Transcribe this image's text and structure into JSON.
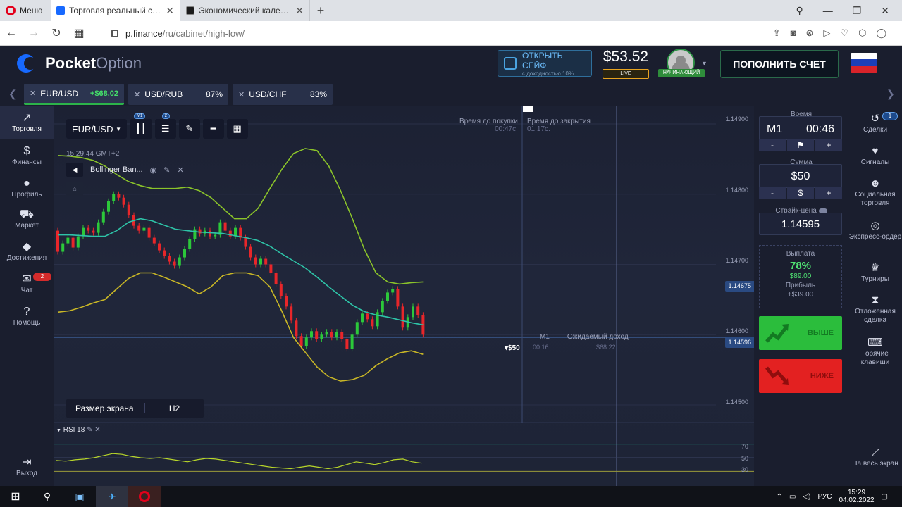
{
  "browser": {
    "menu_label": "Меню",
    "tabs": [
      {
        "label": "Торговля реальный счет",
        "active": true,
        "favicon_color": "#1769ff"
      },
      {
        "label": "Экономический календарь",
        "active": false,
        "favicon_color": "#1c1c1c"
      }
    ],
    "new_tab": "+",
    "url_host": "p.finance",
    "url_path": "/ru/cabinet/high-low/"
  },
  "header": {
    "logo_bold": "Pocket",
    "logo_light": "Option",
    "safe_title": "ОТКРЫТЬ СЕЙФ",
    "safe_subtitle": "с доходностью 10%",
    "balance": "$53.52",
    "account_type": "LIVE",
    "user_level": "НАЧИНАЮЩИЙ",
    "deposit_label": "ПОПОЛНИТЬ СЧЕТ",
    "flag_colors": [
      "#ffffff",
      "#1c3fb8",
      "#d8232a"
    ]
  },
  "assets": [
    {
      "name": "EUR/USD",
      "profit": "+$68.02",
      "active": true
    },
    {
      "name": "USD/RUB",
      "pct": "87%",
      "active": false
    },
    {
      "name": "USD/CHF",
      "pct": "83%",
      "active": false
    }
  ],
  "left_nav": [
    {
      "label": "Торговля",
      "icon": "chart-icon",
      "glyph": "📈",
      "active": true
    },
    {
      "label": "Финансы",
      "icon": "dollar-icon",
      "glyph": "$"
    },
    {
      "label": "Профиль",
      "icon": "user-icon",
      "glyph": "●"
    },
    {
      "label": "Маркет",
      "icon": "cart-icon",
      "glyph": "🛒"
    },
    {
      "label": "Достижения",
      "icon": "diamond-icon",
      "glyph": "◆"
    },
    {
      "label": "Чат",
      "icon": "chat-icon",
      "glyph": "💬",
      "badge": "2"
    },
    {
      "label": "Помощь",
      "icon": "help-icon",
      "glyph": "?"
    }
  ],
  "exit_label": "Выход",
  "chart": {
    "pair_selector": "EUR/USD",
    "timeframe_badge": "M1",
    "indicators_badge": "2",
    "timestamp": "15:29:44 GMT+2",
    "indicator_name": "Bollinger Ban...",
    "screen_size_label": "Размер экрана",
    "screen_size_value": "H2",
    "purchase_label": "Время до покупки",
    "purchase_time": "00:47с.",
    "close_label": "Время до закрытия",
    "close_time": "01:17с.",
    "current_price": "1.14596",
    "crosshair_price": "1.14675",
    "expected_label": "Ожидаемый доход",
    "expected_value": "$68.22",
    "open_trade_tf": "M1",
    "open_trade_time": "00:16",
    "open_trade_amount": "$50",
    "rsi_label": "RSI 18",
    "rsi_levels": [
      "70",
      "50",
      "30"
    ]
  },
  "chart_data": {
    "type": "candlestick",
    "price_axis": {
      "ticks": [
        "1.14900",
        "1.14800",
        "1.14700",
        "1.14600",
        "1.14500"
      ],
      "ylim": [
        1.14475,
        1.14925
      ]
    },
    "bollinger": {
      "upper": [
        1.14855,
        1.14854,
        1.14852,
        1.14848,
        1.1484,
        1.14828,
        1.14818,
        1.14812,
        1.14808,
        1.14808,
        1.14808,
        1.1481,
        1.14805,
        1.14795,
        1.1478,
        1.14765,
        1.14765,
        1.1478,
        1.14808,
        1.14835,
        1.14858,
        1.14865,
        1.14862,
        1.1484,
        1.14805,
        1.14765,
        1.14722,
        1.14688,
        1.14675,
        1.14672,
        1.14674,
        1.14675
      ],
      "middle": [
        1.14742,
        1.14742,
        1.14741,
        1.1474,
        1.1474,
        1.14748,
        1.1476,
        1.14765,
        1.14762,
        1.14756,
        1.1475,
        1.14748,
        1.14746,
        1.14745,
        1.14744,
        1.14741,
        1.14738,
        1.14734,
        1.14726,
        1.14715,
        1.14705,
        1.14695,
        1.14682,
        1.14668,
        1.14655,
        1.14642,
        1.14633,
        1.14628,
        1.14625,
        1.14621,
        1.14617,
        1.14614
      ],
      "lower": [
        1.14632,
        1.14634,
        1.14639,
        1.14645,
        1.1465,
        1.14665,
        1.1468,
        1.14688,
        1.14688,
        1.14682,
        1.14675,
        1.14668,
        1.14658,
        1.14668,
        1.14684,
        1.14688,
        1.14688,
        1.14684,
        1.14668,
        1.14634,
        1.14596,
        1.14575,
        1.14554,
        1.1454,
        1.14534,
        1.14536,
        1.14542,
        1.14556,
        1.14566,
        1.14574,
        1.14577,
        1.14572
      ]
    },
    "candles": [
      [
        1.14748,
        1.14718
      ],
      [
        1.14718,
        1.1473
      ],
      [
        1.1473,
        1.14738
      ],
      [
        1.14738,
        1.14724
      ],
      [
        1.14724,
        1.1474
      ],
      [
        1.1474,
        1.14752
      ],
      [
        1.14752,
        1.14748
      ],
      [
        1.14748,
        1.14745
      ],
      [
        1.14745,
        1.1476
      ],
      [
        1.1476,
        1.14775
      ],
      [
        1.14775,
        1.1479
      ],
      [
        1.1479,
        1.148
      ],
      [
        1.148,
        1.14795
      ],
      [
        1.14795,
        1.14785
      ],
      [
        1.14785,
        1.1477
      ],
      [
        1.1477,
        1.14755
      ],
      [
        1.14755,
        1.14748
      ],
      [
        1.14748,
        1.14752
      ],
      [
        1.14752,
        1.14738
      ],
      [
        1.14738,
        1.1473
      ],
      [
        1.1473,
        1.1472
      ],
      [
        1.1472,
        1.14712
      ],
      [
        1.14712,
        1.14704
      ],
      [
        1.14704,
        1.14698
      ],
      [
        1.14698,
        1.1471
      ],
      [
        1.1471,
        1.14722
      ],
      [
        1.14722,
        1.14736
      ],
      [
        1.14736,
        1.1475
      ],
      [
        1.1475,
        1.14744
      ],
      [
        1.14744,
        1.14748
      ],
      [
        1.14748,
        1.1474
      ],
      [
        1.1474,
        1.14742
      ],
      [
        1.14742,
        1.1476
      ],
      [
        1.1476,
        1.14748
      ],
      [
        1.14748,
        1.1474
      ],
      [
        1.1474,
        1.14752
      ],
      [
        1.14752,
        1.14738
      ],
      [
        1.14738,
        1.14725
      ],
      [
        1.14725,
        1.1471
      ],
      [
        1.1471,
        1.147
      ],
      [
        1.147,
        1.14708
      ],
      [
        1.14708,
        1.147
      ],
      [
        1.147,
        1.14688
      ],
      [
        1.14688,
        1.14672
      ],
      [
        1.14672,
        1.14655
      ],
      [
        1.14655,
        1.1464
      ],
      [
        1.1464,
        1.1462
      ],
      [
        1.1462,
        1.14598
      ],
      [
        1.14598,
        1.14584
      ],
      [
        1.14584,
        1.14596
      ],
      [
        1.14596,
        1.14605
      ],
      [
        1.14605,
        1.14594
      ],
      [
        1.14594,
        1.146
      ],
      [
        1.146,
        1.14604
      ],
      [
        1.14604,
        1.14596
      ],
      [
        1.14596,
        1.14604
      ],
      [
        1.14604,
        1.14594
      ],
      [
        1.14594,
        1.1458
      ],
      [
        1.1458,
        1.146
      ],
      [
        1.146,
        1.14618
      ],
      [
        1.14618,
        1.1463
      ],
      [
        1.1463,
        1.14622
      ],
      [
        1.14622,
        1.14612
      ],
      [
        1.14612,
        1.14632
      ],
      [
        1.14632,
        1.14648
      ],
      [
        1.14648,
        1.1466
      ],
      [
        1.1466,
        1.14665
      ],
      [
        1.14665,
        1.1464
      ],
      [
        1.1464,
        1.1461
      ],
      [
        1.1461,
        1.14625
      ],
      [
        1.14625,
        1.1464
      ],
      [
        1.1464,
        1.14628
      ],
      [
        1.14628,
        1.146
      ]
    ],
    "rsi": {
      "levels": [
        70,
        50,
        30
      ],
      "ylim": [
        20,
        80
      ],
      "values": [
        46,
        45,
        47,
        48,
        50,
        53,
        56,
        55,
        52,
        50,
        49,
        50,
        48,
        46,
        44,
        47,
        49,
        48,
        46,
        44,
        42,
        40,
        38,
        36,
        35,
        34,
        36,
        38,
        36,
        34,
        36,
        40,
        44,
        42,
        40,
        43,
        47,
        48,
        44,
        42
      ]
    }
  },
  "trade_panel": {
    "time_title": "Время",
    "time_tf": "M1",
    "time_value": "00:46",
    "time_minus": "-",
    "time_plus": "+",
    "amount_title": "Сумма",
    "amount_value": "$50",
    "amount_minus": "-",
    "amount_currency": "$",
    "amount_plus": "+",
    "strike_title": "Страйк-цена",
    "strike_value": "1.14595",
    "payout_title": "Выплата",
    "payout_pct": "78%",
    "payout_amount": "$89.00",
    "profit_title": "Прибыль",
    "profit_amount": "+$39.00",
    "up_label": "ВЫШЕ",
    "down_label": "НИЖЕ"
  },
  "right_nav": [
    {
      "label": "Сделки",
      "icon": "history-icon",
      "glyph": "↺",
      "badge": "1"
    },
    {
      "label": "Сигналы",
      "icon": "heartbeat-icon",
      "glyph": "♥"
    },
    {
      "label": "Социальная торговля",
      "icon": "people-icon",
      "glyph": "👥"
    },
    {
      "label": "Экспресс-ордер",
      "icon": "target-icon",
      "glyph": "◎"
    },
    {
      "label": "Турниры",
      "icon": "trophy-icon",
      "glyph": "🏆"
    },
    {
      "label": "Отложенная сделка",
      "icon": "hourglass-icon",
      "glyph": "⌛"
    },
    {
      "label": "Горячие клавиши",
      "icon": "keyboard-icon",
      "glyph": "⌨"
    }
  ],
  "fullscreen_label": "На весь экран",
  "taskbar": {
    "lang": "РУС",
    "time": "15:29",
    "date": "04.02.2022"
  },
  "colors": {
    "bull": "#2cc83a",
    "bear": "#e8262a",
    "bb_upper_lower": "#c8b626",
    "bb_upper": "#8bc42a",
    "bb_middle": "#2ec4a8",
    "rsi_line": "#b8d62a"
  }
}
